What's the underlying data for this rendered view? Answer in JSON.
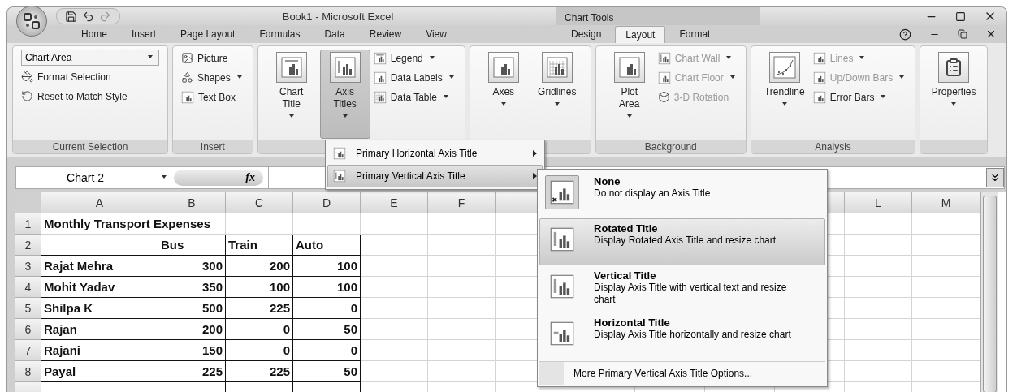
{
  "window": {
    "title": "Book1 - Microsoft Excel",
    "context_title": "Chart Tools"
  },
  "tabs": [
    {
      "label": "Home",
      "selected": false,
      "contextual": false
    },
    {
      "label": "Insert",
      "selected": false,
      "contextual": false
    },
    {
      "label": "Page Layout",
      "selected": false,
      "contextual": false
    },
    {
      "label": "Formulas",
      "selected": false,
      "contextual": false
    },
    {
      "label": "Data",
      "selected": false,
      "contextual": false
    },
    {
      "label": "Review",
      "selected": false,
      "contextual": false
    },
    {
      "label": "View",
      "selected": false,
      "contextual": false
    },
    {
      "label": "Design",
      "selected": false,
      "contextual": true
    },
    {
      "label": "Layout",
      "selected": true,
      "contextual": true
    },
    {
      "label": "Format",
      "selected": false,
      "contextual": true
    }
  ],
  "ribbon": {
    "groups": [
      {
        "label": "Current Selection",
        "dropdown": "Chart Area",
        "small": [
          {
            "label": "Format Selection",
            "dropdown": false,
            "disabled": false
          },
          {
            "label": "Reset to Match Style",
            "dropdown": false,
            "disabled": false
          }
        ]
      },
      {
        "label": "Insert",
        "small": [
          {
            "label": "Picture",
            "dropdown": false,
            "disabled": false
          },
          {
            "label": "Shapes",
            "dropdown": true,
            "disabled": false
          },
          {
            "label": "Text Box",
            "dropdown": false,
            "disabled": false
          }
        ]
      },
      {
        "large": [
          {
            "label": "Chart Title",
            "dropdown": true,
            "pressed": false
          },
          {
            "label": "Axis Titles",
            "dropdown": true,
            "pressed": true
          }
        ],
        "small": [
          {
            "label": "Legend",
            "dropdown": true,
            "disabled": false
          },
          {
            "label": "Data Labels",
            "dropdown": true,
            "disabled": false
          },
          {
            "label": "Data Table",
            "dropdown": true,
            "disabled": false
          }
        ]
      },
      {
        "large": [
          {
            "label": "Axes",
            "dropdown": true,
            "pressed": false
          },
          {
            "label": "Gridlines",
            "dropdown": true,
            "pressed": false
          }
        ]
      },
      {
        "label": "Background",
        "large": [
          {
            "label": "Plot Area",
            "dropdown": true,
            "pressed": false
          }
        ],
        "small": [
          {
            "label": "Chart Wall",
            "dropdown": true,
            "disabled": true
          },
          {
            "label": "Chart Floor",
            "dropdown": true,
            "disabled": true
          },
          {
            "label": "3-D Rotation",
            "dropdown": false,
            "disabled": true
          }
        ]
      },
      {
        "label": "Analysis",
        "large": [
          {
            "label": "Trendline",
            "dropdown": true,
            "pressed": false
          }
        ],
        "small": [
          {
            "label": "Lines",
            "dropdown": true,
            "disabled": true
          },
          {
            "label": "Up/Down Bars",
            "dropdown": true,
            "disabled": true
          },
          {
            "label": "Error Bars",
            "dropdown": true,
            "disabled": false
          }
        ]
      },
      {
        "large": [
          {
            "label": "Properties",
            "dropdown": true,
            "pressed": false
          }
        ]
      }
    ]
  },
  "formula_bar": {
    "name_box": "Chart 2",
    "function_label": "fx"
  },
  "sheet": {
    "columns_left": [
      "A",
      "B",
      "C",
      "D",
      "E",
      "F"
    ],
    "columns_right": [
      "L",
      "M"
    ],
    "rows": [
      {
        "number": "1",
        "kind": "title",
        "text": "Monthly Transport Expenses"
      },
      {
        "number": "2",
        "kind": "header",
        "values": [
          "Bus",
          "Train",
          "Auto"
        ]
      },
      {
        "number": "3",
        "kind": "data",
        "name": "Rajat Mehra",
        "values": [
          "300",
          "200",
          "100"
        ]
      },
      {
        "number": "4",
        "kind": "data",
        "name": "Mohit Yadav",
        "values": [
          "350",
          "100",
          "100"
        ]
      },
      {
        "number": "5",
        "kind": "data",
        "name": "Shilpa K",
        "values": [
          "500",
          "225",
          "0"
        ]
      },
      {
        "number": "6",
        "kind": "data",
        "name": "Rajan",
        "values": [
          "200",
          "0",
          "50"
        ]
      },
      {
        "number": "7",
        "kind": "data",
        "name": "Rajani",
        "values": [
          "150",
          "0",
          "0"
        ]
      },
      {
        "number": "8",
        "kind": "data",
        "name": "Payal",
        "values": [
          "225",
          "225",
          "50"
        ]
      }
    ]
  },
  "axis_titles_menu": {
    "items": [
      {
        "label": "Primary Horizontal Axis Title",
        "highlighted": false
      },
      {
        "label": "Primary Vertical Axis Title",
        "highlighted": true
      }
    ]
  },
  "vertical_axis_menu": {
    "options": [
      {
        "title": "None",
        "description": "Do not display an Axis Title",
        "checked": true,
        "highlighted": false
      },
      {
        "title": "Rotated Title",
        "description": "Display Rotated Axis Title and resize chart",
        "checked": false,
        "highlighted": true
      },
      {
        "title": "Vertical Title",
        "description": "Display Axis Title with vertical text and resize chart",
        "checked": false,
        "highlighted": false
      },
      {
        "title": "Horizontal Title",
        "description": "Display Axis Title horizontally and resize chart",
        "checked": false,
        "highlighted": false
      }
    ],
    "footer": "More Primary Vertical Axis Title Options..."
  }
}
